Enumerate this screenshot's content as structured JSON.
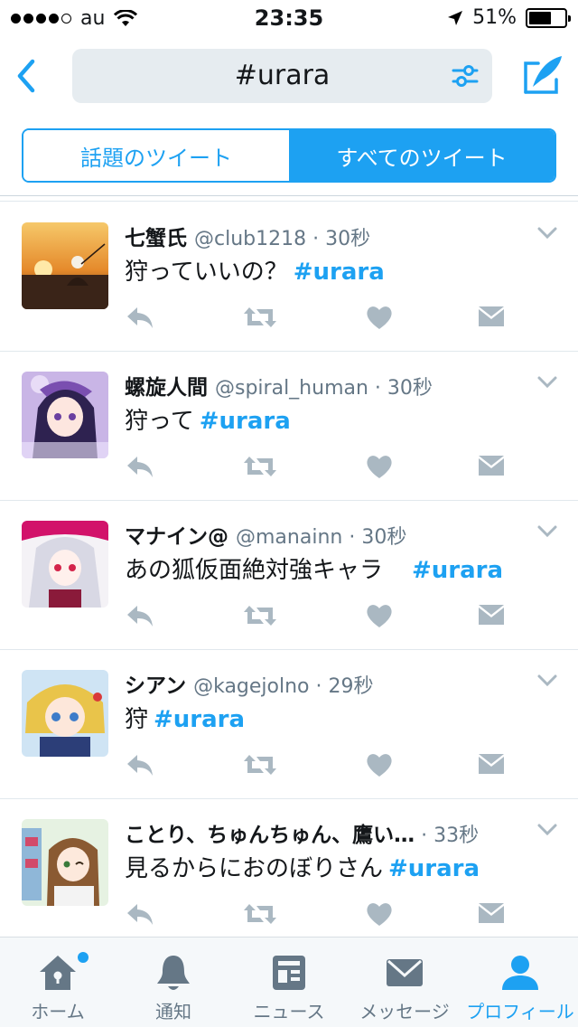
{
  "status": {
    "carrier": "au",
    "time": "23:35",
    "battery": "51%",
    "signal_bars": 4,
    "signal_total": 5
  },
  "nav": {
    "search_query": "#urara"
  },
  "segments": {
    "top": "話題のツイート",
    "all": "すべてのツイート",
    "selected": "all"
  },
  "tweets": [
    {
      "name": "七蟹氏",
      "handle": "@club1218",
      "time": "30秒",
      "text": "狩っていいの？",
      "hashtag": "#urara"
    },
    {
      "name": "螺旋人間",
      "handle": "@spiral_human",
      "time": "30秒",
      "text": "狩って",
      "hashtag": "#urara"
    },
    {
      "name": "マナイン@",
      "handle": "@manainn",
      "time": "30秒",
      "text": "あの狐仮面絶対強キャラ　",
      "hashtag": "#urara"
    },
    {
      "name": "シアン",
      "handle": "@kagejolno",
      "time": "29秒",
      "text": "狩",
      "hashtag": "#urara"
    },
    {
      "name": "ことり、ちゅんちゅん、鷹い…",
      "handle": "",
      "time": "33秒",
      "text": "見るからにおのぼりさん",
      "hashtag": "#urara"
    }
  ],
  "tabbar": {
    "items": [
      {
        "label": "ホーム",
        "icon": "home-icon"
      },
      {
        "label": "通知",
        "icon": "bell-icon"
      },
      {
        "label": "ニュース",
        "icon": "news-icon"
      },
      {
        "label": "メッセージ",
        "icon": "envelope-icon"
      },
      {
        "label": "プロフィール",
        "icon": "person-icon"
      }
    ],
    "active_index": 4
  },
  "colors": {
    "accent": "#1da1f2",
    "icon_gray": "#aab8c2",
    "text_secondary": "#657786"
  }
}
